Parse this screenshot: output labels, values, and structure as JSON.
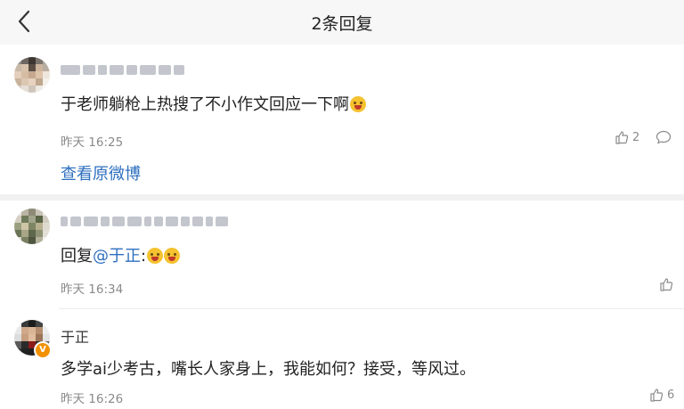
{
  "nav": {
    "title": "2条回复"
  },
  "comments": [
    {
      "text": "于老师躺枪上热搜了不小作文回应一下啊",
      "time": "昨天 16:25",
      "likes": "2",
      "link": "查看原微博"
    },
    {
      "reply_prefix": "回复",
      "mention": "@于正",
      "colon": ":",
      "time": "昨天 16:34",
      "likes": ""
    },
    {
      "author": "于正",
      "text": "多学ai少考古，嘴长人家身上，我能如何？接受，等风过。",
      "time": "昨天 16:26",
      "likes": "6"
    }
  ],
  "colors": {
    "link": "#2e6fbf",
    "verified_badge": "#f29100"
  },
  "icons": [
    "back-icon",
    "thumbs-up-icon",
    "comment-icon",
    "emoji-laugh-icon",
    "emoji-tongue-icon",
    "verified-badge-icon"
  ]
}
